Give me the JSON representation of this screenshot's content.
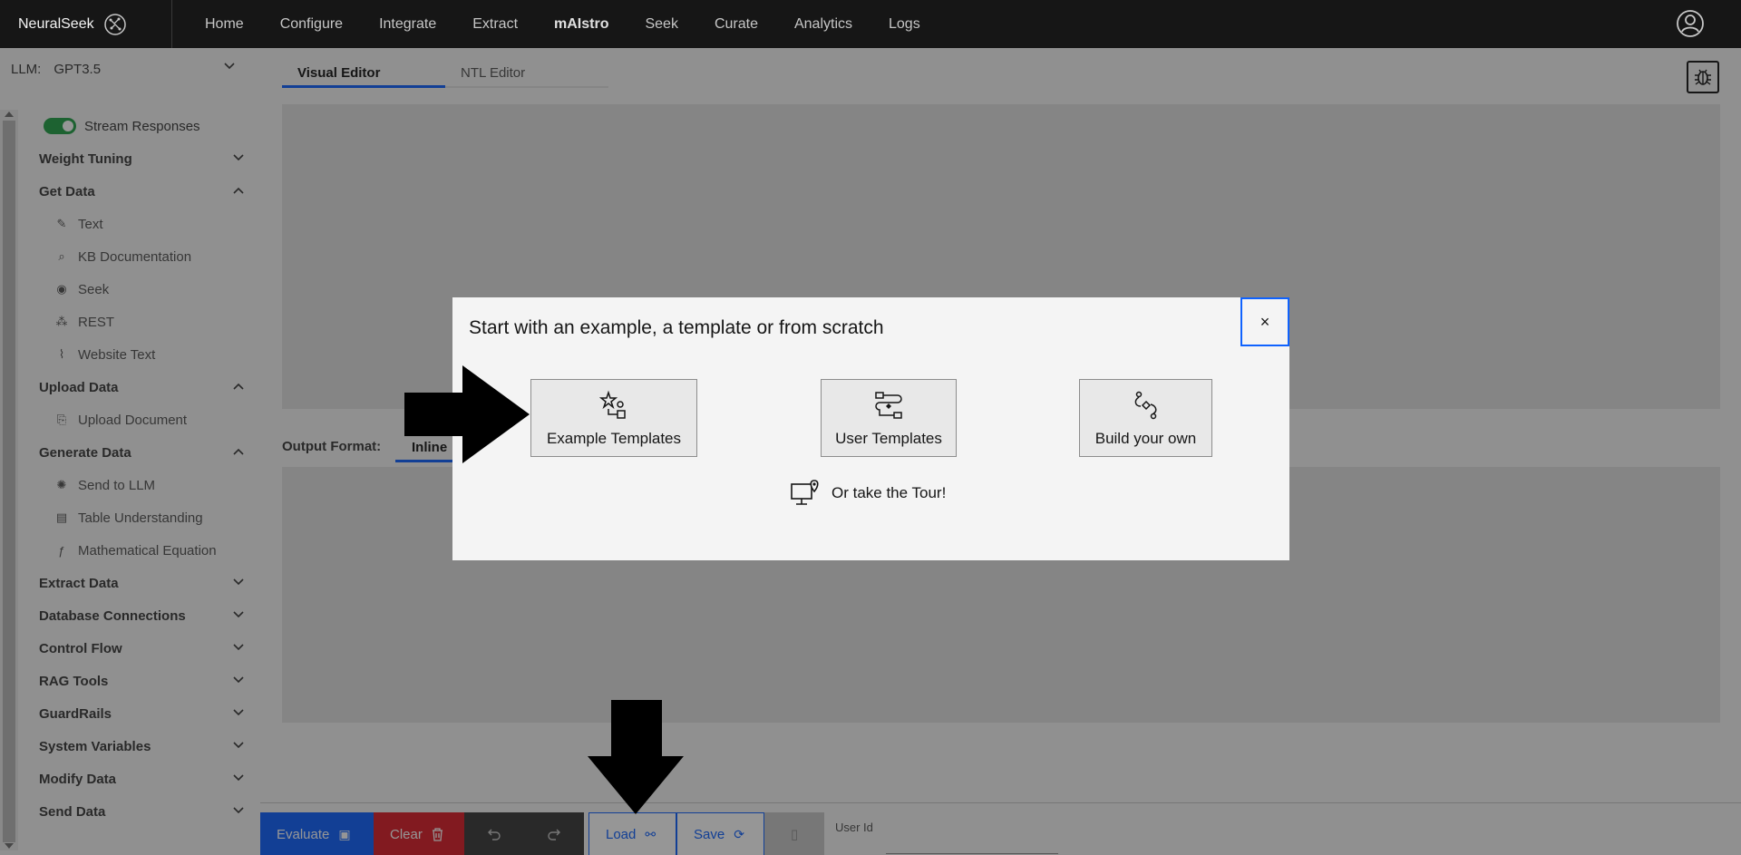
{
  "brand": {
    "name": "NeuralSeek"
  },
  "nav": {
    "items": [
      {
        "label": "Home"
      },
      {
        "label": "Configure"
      },
      {
        "label": "Integrate"
      },
      {
        "label": "Extract"
      },
      {
        "label": "mAIstro"
      },
      {
        "label": "Seek"
      },
      {
        "label": "Curate"
      },
      {
        "label": "Analytics"
      },
      {
        "label": "Logs"
      }
    ]
  },
  "sidebar": {
    "llm_label": "LLM:",
    "llm_value": "GPT3.5",
    "stream_label": "Stream Responses",
    "sections": {
      "weight_tuning": "Weight Tuning",
      "get_data": "Get Data",
      "upload_data": "Upload Data",
      "generate_data": "Generate Data",
      "extract_data": "Extract Data",
      "database_connections": "Database Connections",
      "control_flow": "Control Flow",
      "rag_tools": "RAG Tools",
      "guardrails": "GuardRails",
      "system_variables": "System Variables",
      "modify_data": "Modify Data",
      "send_data": "Send Data"
    },
    "get_data_items": [
      "Text",
      "KB Documentation",
      "Seek",
      "REST",
      "Website Text"
    ],
    "upload_data_items": [
      "Upload Document"
    ],
    "generate_data_items": [
      "Send to LLM",
      "Table Understanding",
      "Mathematical Equation"
    ]
  },
  "main": {
    "tabs": [
      {
        "label": "Visual Editor"
      },
      {
        "label": "NTL Editor"
      }
    ],
    "output_format_label": "Output Format:",
    "output_tab": "Inline"
  },
  "bottombar": {
    "evaluate": "Evaluate",
    "clear": "Clear",
    "load": "Load",
    "save": "Save",
    "user_id_label": "User Id",
    "user_id_value": ""
  },
  "modal": {
    "title": "Start with an example, a template or from scratch",
    "close": "×",
    "options": [
      {
        "label": "Example Templates"
      },
      {
        "label": "User Templates"
      },
      {
        "label": "Build your own"
      }
    ],
    "tour": "Or take the Tour!"
  },
  "colors": {
    "primary": "#0f62fe",
    "danger": "#da1e28",
    "success": "#24a148",
    "topbar": "#161616"
  }
}
